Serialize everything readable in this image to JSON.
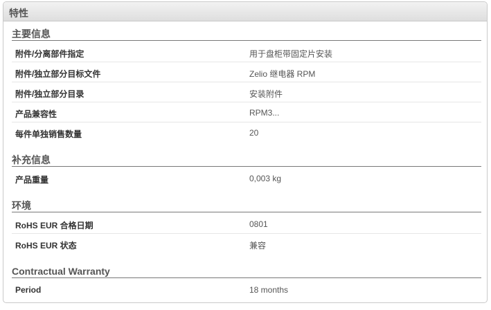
{
  "panel": {
    "title": "特性"
  },
  "sections": [
    {
      "title": "主要信息",
      "rows": [
        {
          "label": "附件/分离部件指定",
          "value": "用于盘柜带固定片安装"
        },
        {
          "label": "附件/独立部分目标文件",
          "value": "Zelio 继电器 RPM"
        },
        {
          "label": "附件/独立部分目录",
          "value": "安装附件"
        },
        {
          "label": "产品兼容性",
          "value": "RPM3..."
        },
        {
          "label": "每件单独销售数量",
          "value": "20"
        }
      ]
    },
    {
      "title": "补充信息",
      "rows": [
        {
          "label": "产品重量",
          "value": "0,003 kg"
        }
      ]
    },
    {
      "title": "环境",
      "rows": [
        {
          "label": "RoHS EUR 合格日期",
          "value": "0801"
        },
        {
          "label": "RoHS EUR 状态",
          "value": "兼容"
        }
      ]
    },
    {
      "title": "Contractual Warranty",
      "rows": [
        {
          "label": "Period",
          "value": "18 months"
        }
      ]
    }
  ]
}
